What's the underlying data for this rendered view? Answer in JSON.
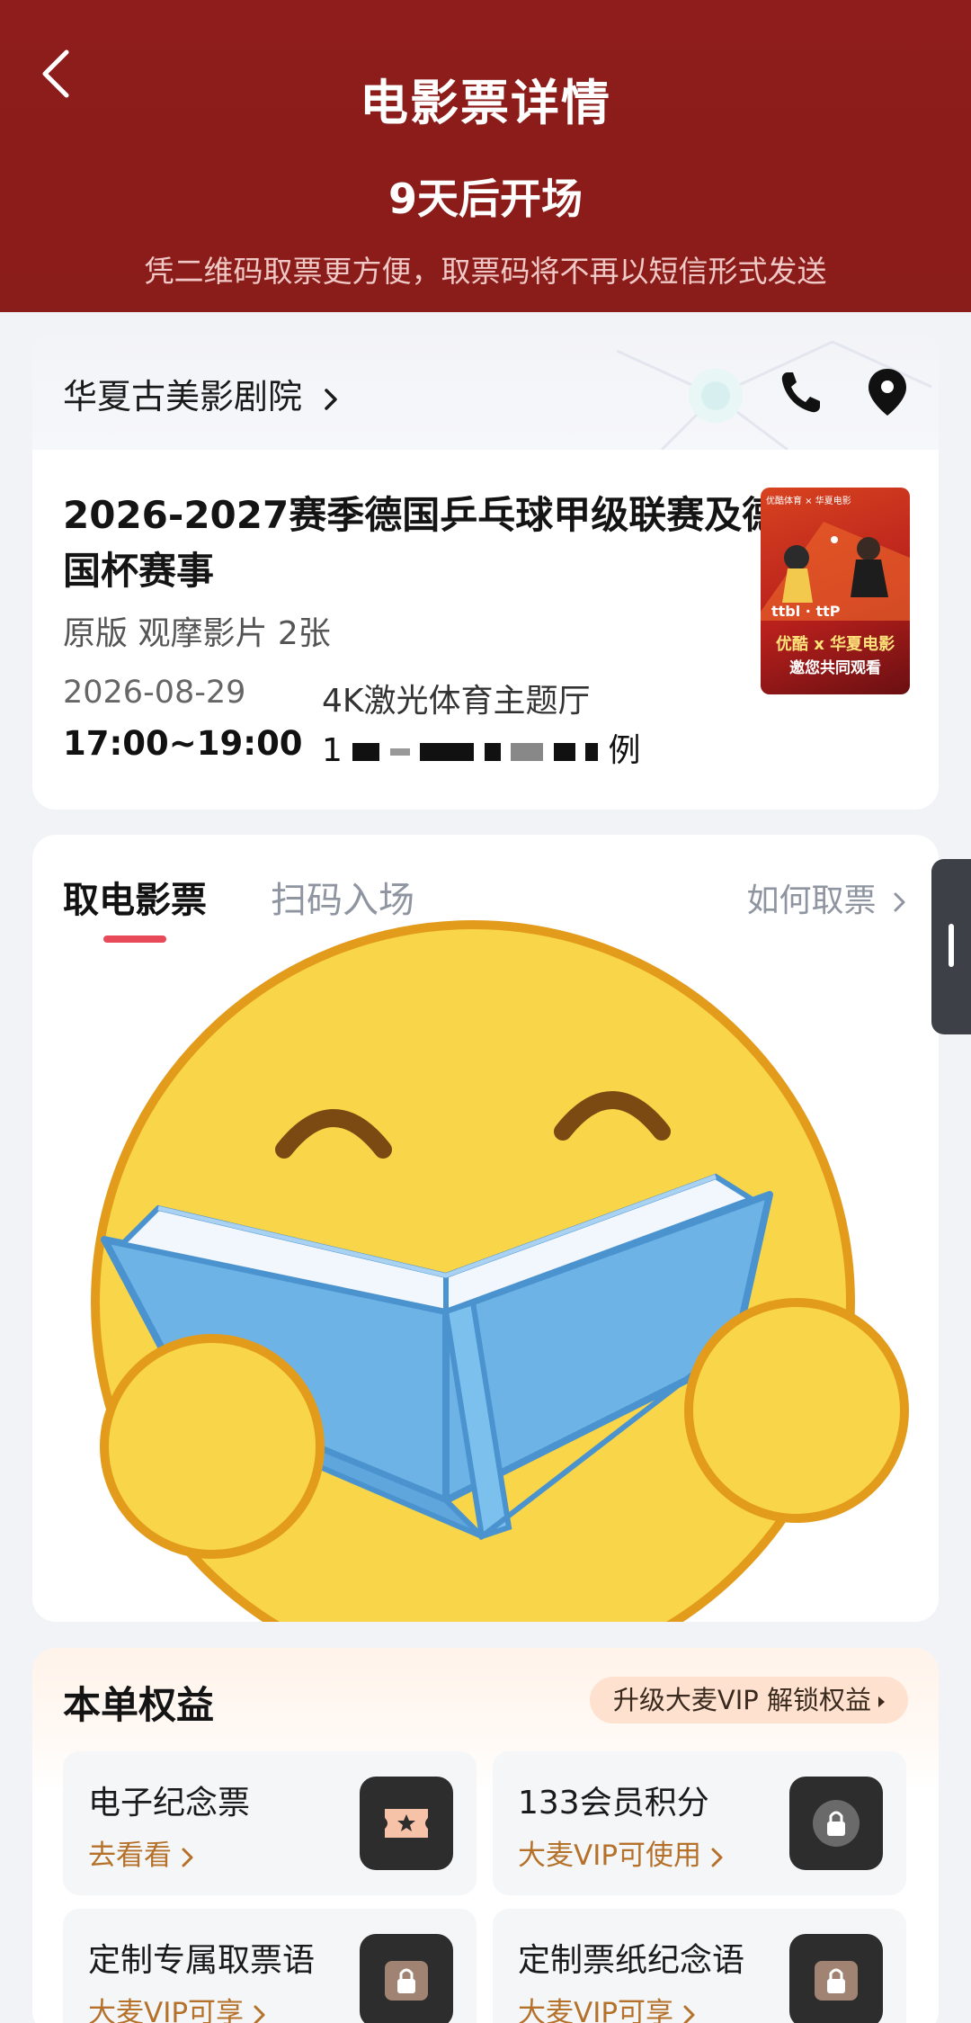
{
  "header": {
    "title": "电影票详情",
    "countdown": "9天后开场",
    "notice": "凭二维码取票更方便，取票码将不再以短信形式发送"
  },
  "cinema": {
    "name": "华夏古美影剧院"
  },
  "movie": {
    "title": "2026-2027赛季德国乒乓球甲级联赛及德国杯赛事",
    "version": "原版 观摩影片 2张",
    "date": "2026-08-29",
    "time": "17:00~19:00",
    "hall": "4K激光体育主题厅",
    "seat_visible_prefix": "1",
    "seat_visible_suffix": "例",
    "poster": {
      "top_text": "优酷体育 × 华夏电影",
      "brand": "优酷 x 华夏电影",
      "sub": "邀您共同观看",
      "logo": "ttbl · ttP"
    }
  },
  "ticket_tabs": {
    "active": "取电影票",
    "inactive": "扫码入场",
    "howto": "如何取票"
  },
  "benefits": {
    "title": "本单权益",
    "vip_button": "升级大麦VIP 解锁权益",
    "items": [
      {
        "title": "电子纪念票",
        "sub": "去看看"
      },
      {
        "title": "133会员积分",
        "sub": "大麦VIP可使用"
      },
      {
        "title": "定制专属取票语",
        "sub": "大麦VIP可享"
      },
      {
        "title": "定制票纸纪念语",
        "sub": "大麦VIP可享"
      }
    ]
  },
  "colors": {
    "header_bg": "#8e1d1b",
    "tab_underline": "#e94a5a",
    "benefit_accent": "#b5712a",
    "emoji_face": "#f9d54a",
    "book": "#6db3e6"
  },
  "icons": [
    "back-icon",
    "chevron-right-icon",
    "phone-icon",
    "location-icon",
    "ticket-star-icon",
    "lock-icon",
    "emoji-reading-icon"
  ]
}
